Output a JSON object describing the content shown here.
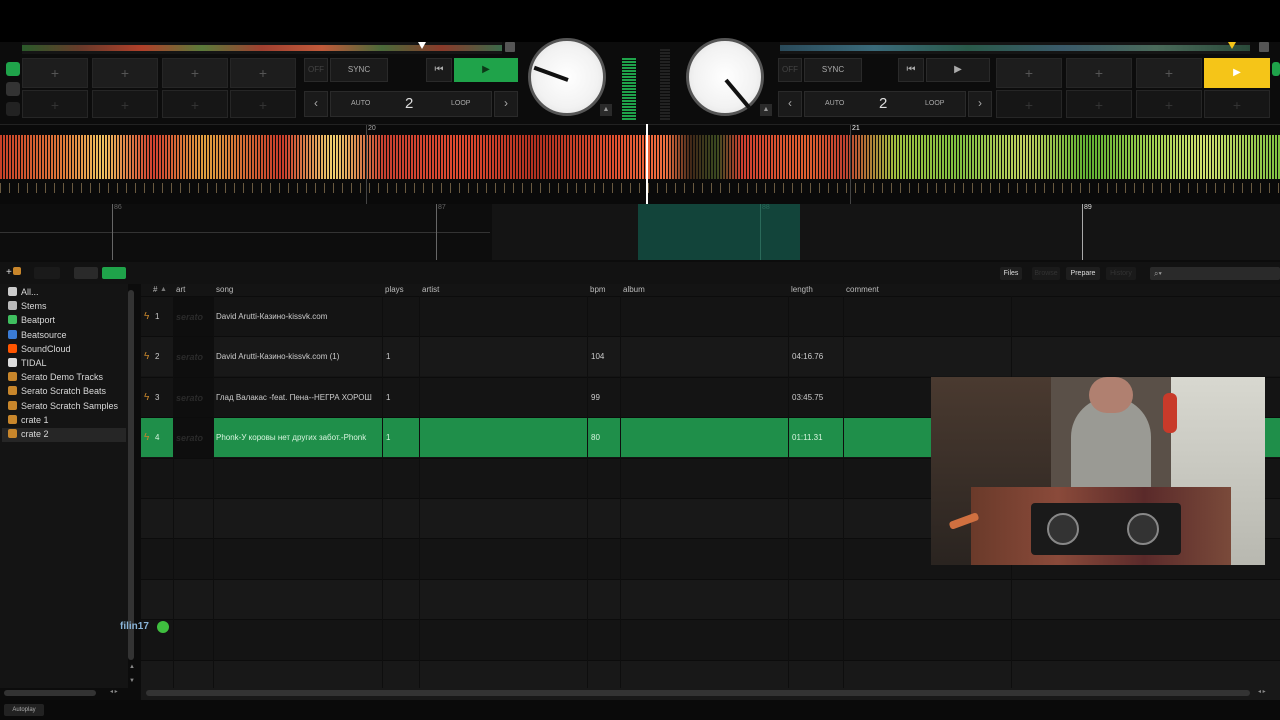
{
  "deck_left": {
    "sync_label": "SYNC",
    "off_label": "OFF",
    "auto_label": "AUTO",
    "loop_value": "2",
    "loop_label": "LOOP",
    "pad_plus": "+"
  },
  "deck_right": {
    "sync_label": "SYNC",
    "off_label": "OFF",
    "auto_label": "AUTO",
    "loop_value": "2",
    "loop_label": "LOOP",
    "pad_plus": "+"
  },
  "waveform": {
    "bar_20": "20",
    "bar_21": "21",
    "beat_86": "86",
    "beat_87": "87",
    "beat_88": "88",
    "beat_89": "89"
  },
  "library": {
    "tabs": {
      "files": "Files",
      "browse": "Browse",
      "prepare": "Prepare",
      "history": "History"
    },
    "columns": {
      "num": "#",
      "art": "art",
      "song": "song",
      "plays": "plays",
      "artist": "artist",
      "bpm": "bpm",
      "album": "album",
      "length": "length",
      "comment": "comment"
    },
    "art_placeholder": "serato",
    "rows": [
      {
        "num": "1",
        "song": "David Arutti-Казино-kissvk.com",
        "plays": "",
        "bpm": "",
        "length": ""
      },
      {
        "num": "2",
        "song": "David Arutti-Казино-kissvk.com (1)",
        "plays": "1",
        "bpm": "104",
        "length": "04:16.76"
      },
      {
        "num": "3",
        "song": "Глад Валакас -feat. Пена--НЕГРА ХОРОШ",
        "plays": "1",
        "bpm": "99",
        "length": "03:45.75"
      },
      {
        "num": "4",
        "song": "Phonk-У коровы нет других забот.-Phonk",
        "plays": "1",
        "bpm": "80",
        "length": "01:11.31"
      }
    ]
  },
  "sidebar": {
    "items": [
      {
        "label": "All...",
        "icon": "star-icon",
        "color": "#cccccc"
      },
      {
        "label": "Stems",
        "icon": "stems-icon",
        "color": "#bbbbbb"
      },
      {
        "label": "Beatport",
        "icon": "beatport-icon",
        "color": "#3fbf5f"
      },
      {
        "label": "Beatsource",
        "icon": "beatsource-icon",
        "color": "#3a7bd5"
      },
      {
        "label": "SoundCloud",
        "icon": "soundcloud-icon",
        "color": "#ff5500"
      },
      {
        "label": "TIDAL",
        "icon": "tidal-icon",
        "color": "#dddddd"
      },
      {
        "label": "Serato Demo Tracks",
        "icon": "crate-icon",
        "color": "#c8862b"
      },
      {
        "label": "Serato Scratch Beats",
        "icon": "crate-icon",
        "color": "#c8862b"
      },
      {
        "label": "Serato Scratch Samples",
        "icon": "crate-icon",
        "color": "#c8862b"
      },
      {
        "label": "crate 1",
        "icon": "crate-icon",
        "color": "#c8862b"
      },
      {
        "label": "crate 2",
        "icon": "crate-icon",
        "color": "#c8862b"
      }
    ]
  },
  "chat": {
    "username": "filin17"
  },
  "footer": {
    "autoplay_label": "Autoplay"
  },
  "colors": {
    "accent_green": "#1fa34a",
    "accent_yellow": "#f5c518",
    "selected_row": "#1f8f4a"
  }
}
